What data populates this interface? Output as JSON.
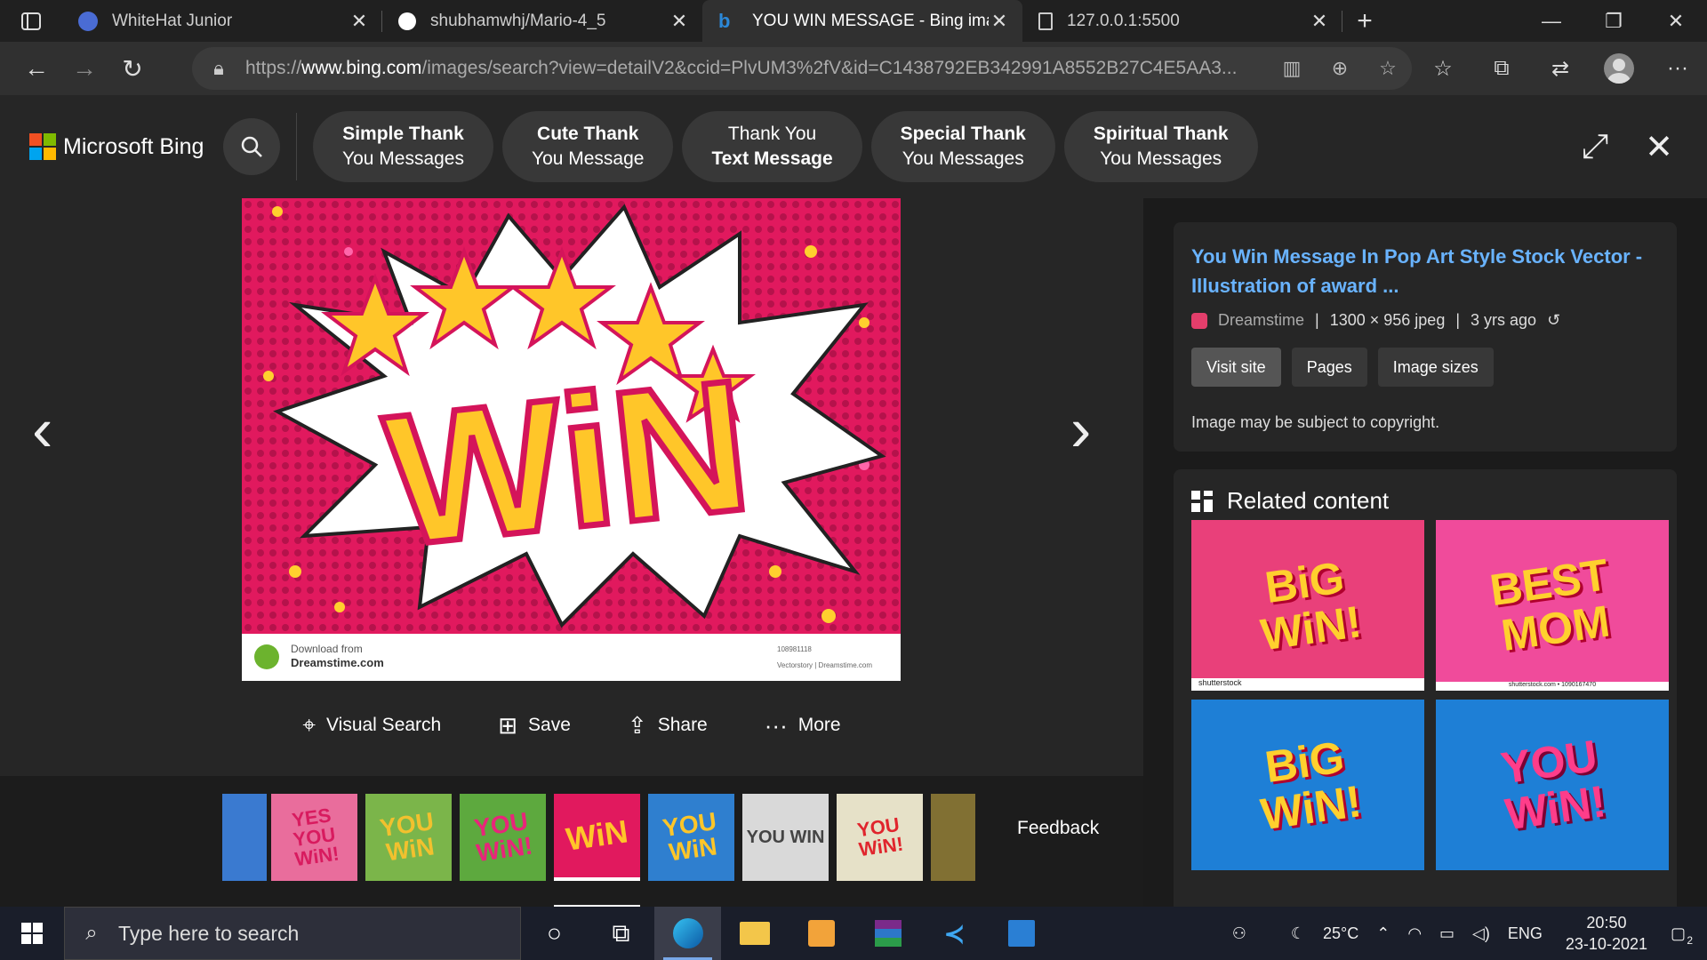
{
  "tabs": [
    {
      "title": "WhiteHat Junior",
      "favicon_color": "#4a6cd4"
    },
    {
      "title": "shubhamwhj/Mario-4_5",
      "favicon_color": "#ffffff"
    },
    {
      "title": "YOU WIN MESSAGE - Bing images",
      "favicon_color": "#2b88d8",
      "active": true
    },
    {
      "title": "127.0.0.1:5500",
      "favicon_color": "#cccccc"
    }
  ],
  "address": {
    "prefix": "https://",
    "domain": "www.bing.com",
    "path": "/images/search?view=detailV2&ccid=PlvUM3%2fV&id=C1438792EB342991A8552B27C4E5AA3..."
  },
  "bing": {
    "logo_text": "Microsoft Bing",
    "chips": [
      {
        "line1": "Simple Thank",
        "line2": "You Messages",
        "bold_line": 1
      },
      {
        "line1": "Cute Thank",
        "line2": "You Message",
        "bold_line": 1
      },
      {
        "line1": "Thank You",
        "line2": "Text Message",
        "bold_line": 2
      },
      {
        "line1": "Special Thank",
        "line2": "You Messages",
        "bold_line": 1
      },
      {
        "line1": "Spiritual Thank",
        "line2": "You Messages",
        "bold_line": 1
      }
    ]
  },
  "viewer": {
    "image_text": "WiN",
    "watermark_line1": "Download from",
    "watermark_line2": "Dreamstime.com",
    "watermark_id": "108981118",
    "watermark_credit": "Vectorstory | Dreamstime.com",
    "actions": [
      "Visual Search",
      "Save",
      "Share",
      "More"
    ],
    "feedback": "Feedback",
    "thumbs": [
      {
        "text": "",
        "bg": "#3a7ad0"
      },
      {
        "text": "YES YOU WiN!",
        "bg": "#e96d9c",
        "fg": "#d81b5f"
      },
      {
        "text": "YOU WiN",
        "bg": "#7bb54a",
        "fg": "#f2c12e"
      },
      {
        "text": "YOU WiN!",
        "bg": "#5da93e",
        "fg": "#e8257a"
      },
      {
        "text": "WiN",
        "bg": "#e1195e",
        "fg": "#ffc629"
      },
      {
        "text": "YOU WiN",
        "bg": "#2f7fcf",
        "fg": "#ffc629"
      },
      {
        "text": "YOU WIN",
        "bg": "#d9d9d9",
        "fg": "#444444"
      },
      {
        "text": "YOU WiN!",
        "bg": "#e6e1c8",
        "fg": "#e0252d"
      },
      {
        "text": "",
        "bg": "#e6c34a"
      }
    ]
  },
  "details": {
    "title": "You Win Message In Pop Art Style Stock Vector - Illustration of award ...",
    "source": "Dreamstime",
    "size": "1300 × 956 jpeg",
    "age": "3 yrs ago",
    "buttons": [
      "Visit site",
      "Pages",
      "Image sizes"
    ],
    "copyright": "Image may be subject to copyright.",
    "related_title": "Related content",
    "related": [
      {
        "l1": "BiG",
        "l2": "WiN!",
        "bg": "#e9407a",
        "fg": "#ffd02e",
        "caption": "shutterstock"
      },
      {
        "l1": "BEST",
        "l2": "MOM",
        "bg": "#f04b9b",
        "fg": "#ffd02e",
        "caption": "shutterstock.com • 1090167470"
      },
      {
        "l1": "BiG",
        "l2": "WiN!",
        "bg": "#1e7fd6",
        "fg": "#ffd02e",
        "caption": ""
      },
      {
        "l1": "YOU",
        "l2": "WiN!",
        "bg": "#1e7fd6",
        "fg": "#ff3d8a",
        "caption": ""
      }
    ]
  },
  "taskbar": {
    "search_placeholder": "Type here to search",
    "temperature": "25°C",
    "lang": "ENG",
    "time": "20:50",
    "date": "23-10-2021",
    "notif_count": "2"
  }
}
